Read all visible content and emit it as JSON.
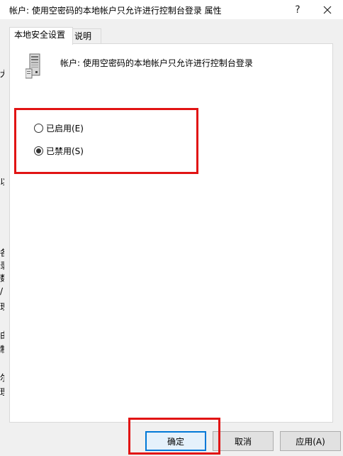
{
  "window": {
    "title": "帐户: 使用空密码的本地帐户只允许进行控制台登录 属性",
    "help_label": "?"
  },
  "tabs": [
    {
      "label": "本地安全设置",
      "active": true
    },
    {
      "label": "说明",
      "active": false
    }
  ],
  "policy": {
    "icon": "server-icon",
    "text": "帐户: 使用空密码的本地帐户只允许进行控制台登录"
  },
  "options": [
    {
      "label": "已启用(E)",
      "checked": false
    },
    {
      "label": "已禁用(S)",
      "checked": true
    }
  ],
  "buttons": {
    "ok": "确定",
    "cancel": "取消",
    "apply": "应用(A)"
  },
  "background_fragments": [
    "犬",
    "以",
    "各",
    "录",
    "数",
    "/",
    "现",
    "由",
    "制",
    "尔",
    "理"
  ],
  "colors": {
    "highlight": "#e11414",
    "accent": "#0078d7"
  }
}
